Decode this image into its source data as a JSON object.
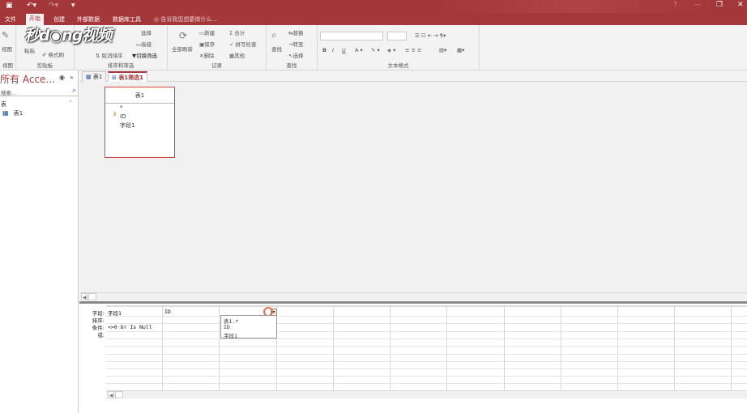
{
  "colors": {
    "accent": "#a4373a"
  },
  "quick_access": {
    "save_icon": "save-icon",
    "undo_icon": "undo-icon",
    "redo_icon": "redo-icon"
  },
  "window": {
    "help": "?",
    "min": "—",
    "restore": "❐",
    "close": "✕"
  },
  "menu": {
    "file": "文件",
    "home": "开始",
    "create": "创建",
    "external": "外部数据",
    "dbtools": "数据库工具",
    "tell": "告诉我您想要做什么..."
  },
  "logo": "秒d◉ng视频",
  "ribbon": {
    "view": {
      "btn": "视图",
      "label": "视图"
    },
    "clipboard": {
      "paste": "粘贴",
      "format": "格式刷",
      "label": "剪贴板"
    },
    "sort": {
      "select": "选择",
      "advanced": "高级",
      "cancel": "取消排序",
      "toggle": "切换筛选",
      "label": "排序和筛选"
    },
    "records": {
      "refresh": "全部刷新",
      "new": "新建",
      "save": "保存",
      "delete": "删除",
      "total": "合计",
      "spell": "拼写检查",
      "more": "其他",
      "label": "记录"
    },
    "find": {
      "find": "查找",
      "replace": "替换",
      "goto": "转至",
      "select": "选择",
      "label": "查找"
    },
    "text": {
      "b": "B",
      "i": "I",
      "u": "U",
      "label": "文本格式"
    }
  },
  "nav": {
    "title": "所有 Acce...",
    "search_placeholder": "搜索...",
    "section": "表",
    "item": "表1"
  },
  "tabs": [
    {
      "label": "表1"
    },
    {
      "label": "表1筛选1"
    }
  ],
  "table_box": {
    "title": "表1",
    "fields": [
      "*",
      "ID",
      "字段1"
    ]
  },
  "grid": {
    "labels": [
      "字段:",
      "排序:",
      "条件:",
      "或:"
    ],
    "col1_field": "字段1",
    "col1_criteria": "<>0 Or Is Null",
    "col2_field": "ID",
    "dropdown": [
      "表1.*",
      "ID",
      "字段1"
    ]
  }
}
